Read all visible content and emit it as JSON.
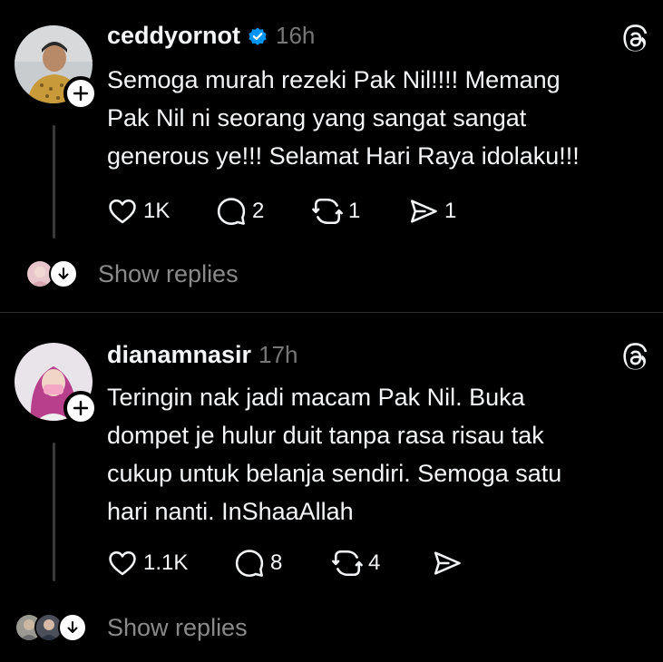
{
  "posts": [
    {
      "username": "ceddyornot",
      "verified": true,
      "time": "16h",
      "text": "Semoga murah rezeki Pak Nil!!!! Memang\nPak Nil ni seorang yang sangat sangat\ngenerous ye!!! Selamat Hari Raya idolaku!!!",
      "likes": "1K",
      "replies": "2",
      "reposts": "1",
      "shares": "1",
      "show_replies": "Show replies"
    },
    {
      "username": "dianamnasir",
      "verified": false,
      "time": "17h",
      "text": "Teringin nak jadi macam Pak Nil. Buka\ndompet je hulur duit tanpa rasa risau tak\ncukup untuk belanja sendiri. Semoga satu\nhari nanti. InShaaAllah",
      "likes": "1.1K",
      "replies": "8",
      "reposts": "4",
      "shares": "",
      "show_replies": "Show replies"
    }
  ],
  "icons": {
    "verified": "verified-badge-icon",
    "logo": "threads-logo-icon",
    "like": "heart-icon",
    "reply": "comment-icon",
    "repost": "repost-icon",
    "share": "send-icon",
    "follow": "plus-icon",
    "expand": "arrow-down-icon"
  },
  "colors": {
    "background": "#000000",
    "text": "#f3f5f7",
    "muted": "#8a8a8a",
    "verified": "#0095f6"
  }
}
